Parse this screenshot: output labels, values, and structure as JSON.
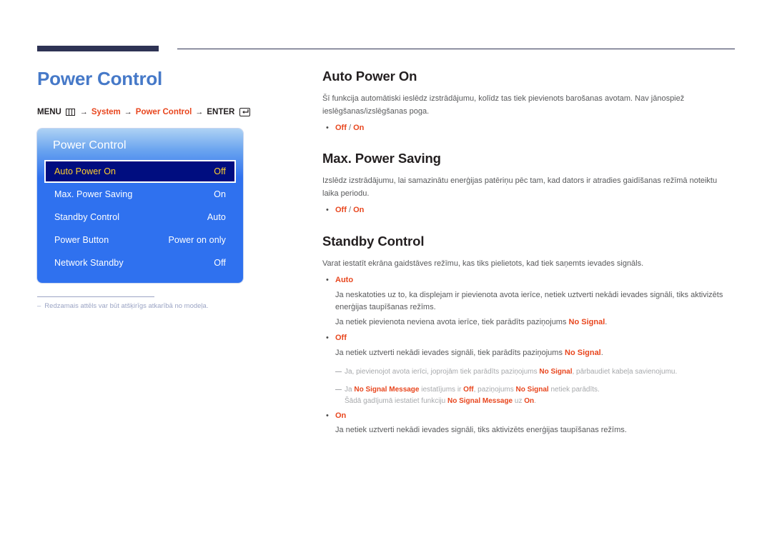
{
  "page": {
    "title": "Power Control",
    "title_color": "#4679c8"
  },
  "breadcrumb": {
    "menu_label": "MENU",
    "menu_icon": "menu-grid-icon",
    "arrow": "→",
    "item1": "System",
    "item2": "Power Control",
    "enter_label": "ENTER",
    "enter_icon": "enter-key-icon"
  },
  "osd": {
    "title": "Power Control",
    "rows": [
      {
        "label": "Auto Power On",
        "value": "Off",
        "selected": true
      },
      {
        "label": "Max. Power Saving",
        "value": "On",
        "selected": false
      },
      {
        "label": "Standby Control",
        "value": "Auto",
        "selected": false
      },
      {
        "label": "Power Button",
        "value": "Power on only",
        "selected": false
      },
      {
        "label": "Network Standby",
        "value": "Off",
        "selected": false
      }
    ],
    "selected_bg": "#000d80",
    "selected_text": "#ffd02e",
    "panel_blue": "#2f71ef"
  },
  "footnote": {
    "dash": "–",
    "text": "Redzamais attēls var būt atšķirīgs atkarībā no modeļa."
  },
  "sections": {
    "auto_power_on": {
      "title": "Auto Power On",
      "intro": "Šī funkcija automātiski ieslēdz izstrādājumu, kolīdz tas tiek pievienots barošanas avotam. Nav jānospiež ieslēgšanas/izslēgšanas poga.",
      "bullet_dot": "•",
      "opt_off": "Off",
      "opt_sep": " / ",
      "opt_on": "On"
    },
    "max_power_saving": {
      "title": "Max. Power Saving",
      "intro": "Izslēdz izstrādājumu, lai samazinātu enerģijas patēriņu pēc tam, kad dators ir atradies gaidīšanas režīmā noteiktu laika periodu.",
      "bullet_dot": "•",
      "opt_off": "Off",
      "opt_sep": " / ",
      "opt_on": "On"
    },
    "standby_control": {
      "title": "Standby Control",
      "intro": "Varat iestatīt ekrāna gaidstāves režīmu, kas tiks pielietots, kad tiek saņemts ievades signāls.",
      "bullet_dot": "•",
      "auto": {
        "label": "Auto",
        "line1": "Ja neskatoties uz to, ka displejam ir pievienota avota ierīce, netiek uztverti nekādi ievades signāli, tiks aktivizēts enerģijas taupīšanas režīms.",
        "line2_pre": "Ja netiek pievienota neviena avota ierīce, tiek parādīts paziņojums ",
        "line2_em": "No Signal",
        "line2_post": "."
      },
      "off": {
        "label": "Off",
        "line1_pre": "Ja netiek uztverti nekādi ievades signāli, tiek parādīts paziņojums ",
        "line1_em": "No Signal",
        "line1_post": ".",
        "note1_pre": "Ja, pievienojot avota ierīci, joprojām tiek parādīts paziņojums ",
        "note1_em": "No Signal",
        "note1_post": ", pārbaudiet kabeļa savienojumu.",
        "note2_a": "Ja ",
        "note2_em1": "No Signal Message",
        "note2_b": " iestatījums ir ",
        "note2_em2": "Off",
        "note2_c": ", paziņojums ",
        "note2_em3": "No Signal",
        "note2_d": " netiek parādīts.",
        "note2_line2_a": "Šādā gadījumā iestatiet funkciju ",
        "note2_line2_em1": "No Signal Message",
        "note2_line2_b": " uz ",
        "note2_line2_em2": "On",
        "note2_line2_c": "."
      },
      "on": {
        "label": "On",
        "line1": "Ja netiek uztverti nekādi ievades signāli, tiks aktivizēts enerģijas taupīšanas režīms."
      }
    }
  }
}
